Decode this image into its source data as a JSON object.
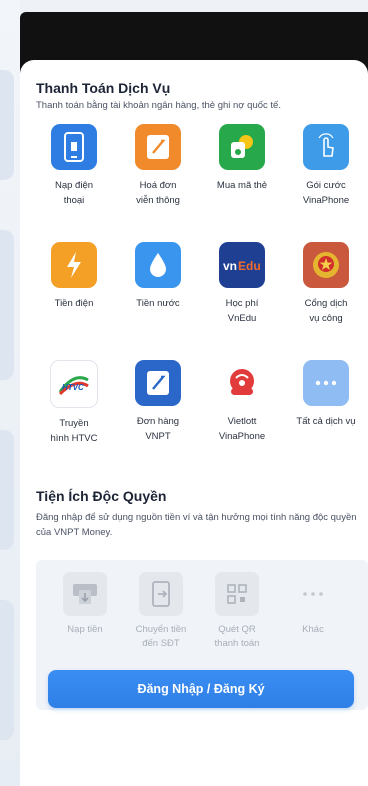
{
  "payment": {
    "title": "Thanh Toán Dịch Vụ",
    "subtitle": "Thanh toán bằng tài khoản ngân hàng, thẻ ghi nợ quốc tế.",
    "services": [
      {
        "label": "Nạp điện\nthoại",
        "icon": "phone-topup-icon",
        "color": "#2f7de3"
      },
      {
        "label": "Hoá đơn\nviễn thông",
        "icon": "telecom-bill-icon",
        "color": "#f08a2b"
      },
      {
        "label": "Mua mã thẻ",
        "icon": "buy-card-code-icon",
        "color": "#27a84a"
      },
      {
        "label": "Gói cước\nVinaPhone",
        "icon": "vinaphone-plan-icon",
        "color": "#3e9be8"
      },
      {
        "label": "Tiền điện",
        "icon": "electricity-icon",
        "color": "#f4a026"
      },
      {
        "label": "Tiền nước",
        "icon": "water-drop-icon",
        "color": "#3a95ee"
      },
      {
        "label": "Học phí\nVnEdu",
        "icon": "vnedu-logo-icon",
        "color": "#1f3f93"
      },
      {
        "label": "Cổng dịch\nvụ công",
        "icon": "public-service-emblem-icon",
        "color": "#c9583d"
      },
      {
        "label": "Truyền\nhình HTVC",
        "icon": "htvc-logo-icon",
        "color": "#ffffff"
      },
      {
        "label": "Đơn hàng\nVNPT",
        "icon": "vnpt-order-icon",
        "color": "#2b67c9"
      },
      {
        "label": "Vietlott\nVinaPhone",
        "icon": "vietlott-logo-icon",
        "color": "#ffffff"
      },
      {
        "label": "Tất cả dịch vụ",
        "icon": "more-dots-icon",
        "color": "#8fbcf2"
      }
    ]
  },
  "exclusive": {
    "title": "Tiện Ích Độc Quyền",
    "subtitle": "Đăng nhập để sử dụng nguồn tiền ví và tận hưởng mọi tính năng độc quyền của VNPT Money.",
    "tiles": [
      {
        "label": "Nạp tiền",
        "icon": "deposit-icon"
      },
      {
        "label": "Chuyển tiền\nđến SĐT",
        "icon": "transfer-to-phone-icon"
      },
      {
        "label": "Quét QR\nthanh toán",
        "icon": "qr-scan-icon"
      },
      {
        "label": "Khác",
        "icon": "more-dots-icon"
      }
    ],
    "login_button": "Đăng Nhập / Đăng Ký"
  }
}
